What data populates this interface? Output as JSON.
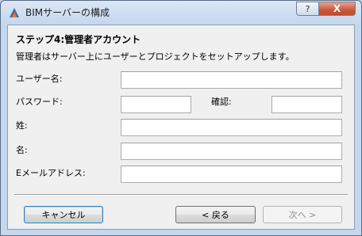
{
  "window": {
    "title": "BIMサーバーの構成",
    "help_label": "?",
    "close_label": "X"
  },
  "step": {
    "title": "ステップ4:管理者アカウント",
    "description": "管理者はサーバー上にユーザーとプロジェクトをセットアップします。"
  },
  "form": {
    "username_label": "ユーザー名:",
    "password_label": "パスワード:",
    "confirm_label": "確認:",
    "lastname_label": "姓:",
    "firstname_label": "名:",
    "email_label": "Eメールアドレス:",
    "username_value": "",
    "password_value": "",
    "confirm_value": "",
    "lastname_value": "",
    "firstname_value": "",
    "email_value": ""
  },
  "buttons": {
    "cancel": "キャンセル",
    "back": "< 戻る",
    "next": "次へ >"
  }
}
